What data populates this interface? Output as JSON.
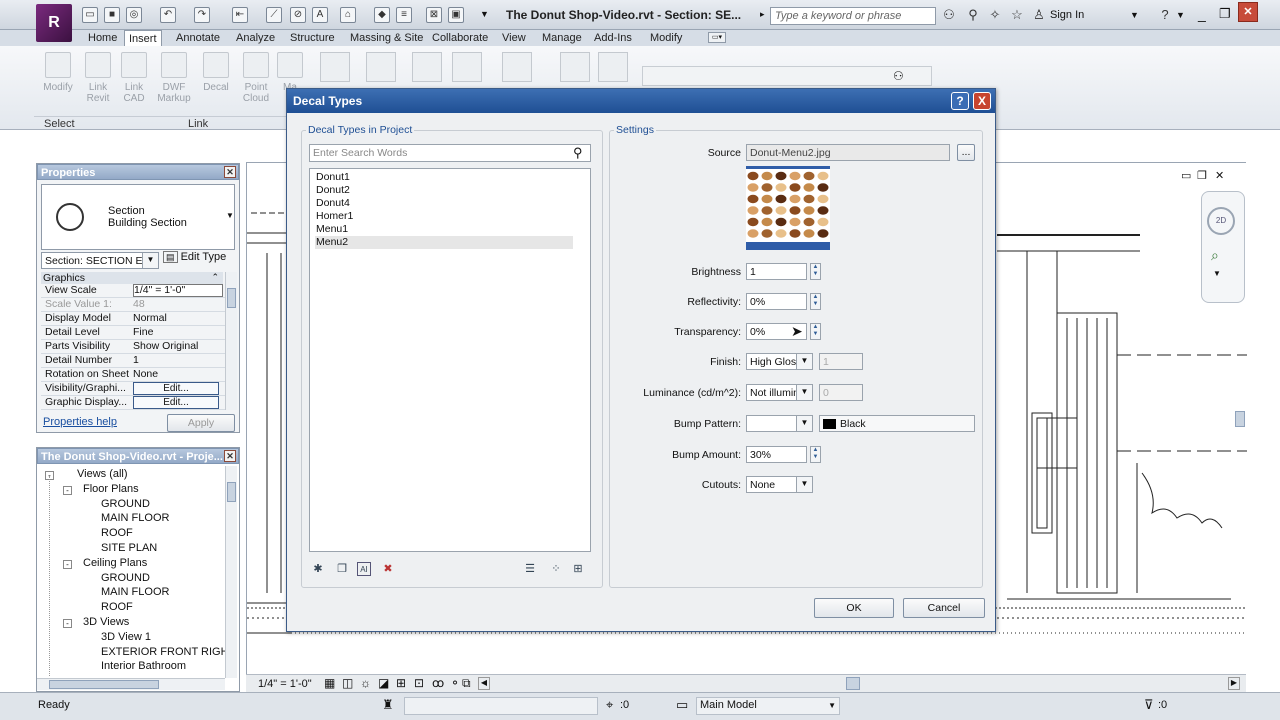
{
  "title_bar": {
    "document_title": "The Donut Shop-Video.rvt - Section: SE...",
    "search_placeholder": "Type a keyword or phrase",
    "sign_in": "Sign In",
    "app_letter": "R"
  },
  "ribbon": {
    "tabs": [
      "Home",
      "Insert",
      "Annotate",
      "Analyze",
      "Structure",
      "Massing & Site",
      "Collaborate",
      "View",
      "Manage",
      "Add-Ins",
      "Modify"
    ],
    "active_tab": "Insert",
    "buttons": [
      {
        "label": "Modify",
        "icon": "arrow-cursor-icon"
      },
      {
        "label": "Link\nRevit",
        "icon": "link-revit-icon"
      },
      {
        "label": "Link\nCAD",
        "icon": "link-cad-icon"
      },
      {
        "label": "DWF\nMarkup",
        "icon": "dwf-markup-icon"
      },
      {
        "label": "Decal",
        "icon": "decal-icon"
      },
      {
        "label": "Point\nCloud",
        "icon": "point-cloud-icon"
      },
      {
        "label": "Ma",
        "icon": "manage-links-icon"
      }
    ],
    "panel_labels": {
      "select": "Select",
      "link": "Link"
    }
  },
  "properties": {
    "title": "Properties",
    "type_family": "Section",
    "type_name": "Building Section",
    "instance_selector": "Section: SECTION EA",
    "edit_type": "Edit Type",
    "category": "Graphics",
    "rows": [
      {
        "key": "View Scale",
        "value": "1/4\" = 1'-0\"",
        "disabled": false
      },
      {
        "key": "Scale Value    1:",
        "value": "48",
        "disabled": true
      },
      {
        "key": "Display Model",
        "value": "Normal",
        "disabled": false
      },
      {
        "key": "Detail Level",
        "value": "Fine",
        "disabled": false
      },
      {
        "key": "Parts Visibility",
        "value": "Show Original",
        "disabled": false
      },
      {
        "key": "Detail Number",
        "value": "1",
        "disabled": false
      },
      {
        "key": "Rotation on Sheet",
        "value": "None",
        "disabled": false
      },
      {
        "key": "Visibility/Graphi...",
        "value": "Edit...",
        "button": true
      },
      {
        "key": "Graphic Display...",
        "value": "Edit...",
        "button": true
      }
    ],
    "help_link": "Properties help",
    "apply": "Apply"
  },
  "project_browser": {
    "title": "The Donut Shop-Video.rvt - Proje...",
    "tree": [
      {
        "label": "Views (all)",
        "level": 0,
        "expander": "-"
      },
      {
        "label": "Floor Plans",
        "level": 1,
        "expander": "-"
      },
      {
        "label": "GROUND",
        "level": 2
      },
      {
        "label": "MAIN FLOOR",
        "level": 2
      },
      {
        "label": "ROOF",
        "level": 2
      },
      {
        "label": "SITE PLAN",
        "level": 2
      },
      {
        "label": "Ceiling Plans",
        "level": 1,
        "expander": "-"
      },
      {
        "label": "GROUND",
        "level": 2
      },
      {
        "label": "MAIN FLOOR",
        "level": 2
      },
      {
        "label": "ROOF",
        "level": 2
      },
      {
        "label": "3D Views",
        "level": 1,
        "expander": "-"
      },
      {
        "label": "3D View 1",
        "level": 2
      },
      {
        "label": "EXTERIOR FRONT RIGHT",
        "level": 2
      },
      {
        "label": "Interior Bathroom",
        "level": 2
      }
    ]
  },
  "view_control_bar": {
    "scale": "1/4\" = 1'-0\""
  },
  "status_bar": {
    "status": "Ready",
    "worksets": ":0",
    "model": "Main Model",
    "filter": ":0"
  },
  "dialog": {
    "title": "Decal Types",
    "left_group": "Decal Types in Project",
    "search_placeholder": "Enter Search Words",
    "decals": [
      "Donut1",
      "Donut2",
      "Donut4",
      "Homer1",
      "Menu1",
      "Menu2"
    ],
    "selected_decal": "Menu2",
    "settings_group": "Settings",
    "source_label": "Source",
    "source_value": "Donut-Menu2.jpg",
    "browse": "...",
    "brightness_label": "Brightness",
    "brightness": "1",
    "reflectivity_label": "Reflectivity:",
    "reflectivity": "0%",
    "transparency_label": "Transparency:",
    "transparency": "0%",
    "finish_label": "Finish:",
    "finish": "High Glos:",
    "finish_value": "1",
    "luminance_label": "Luminance (cd/m^2):",
    "luminance": "Not illumin",
    "luminance_value": "0",
    "bump_pattern_label": "Bump Pattern:",
    "bump_pattern": "",
    "bump_color": "Black",
    "bump_amount_label": "Bump Amount:",
    "bump_amount": "30%",
    "cutouts_label": "Cutouts:",
    "cutouts": "None",
    "ok": "OK",
    "cancel": "Cancel",
    "help": "?",
    "close": "X"
  }
}
